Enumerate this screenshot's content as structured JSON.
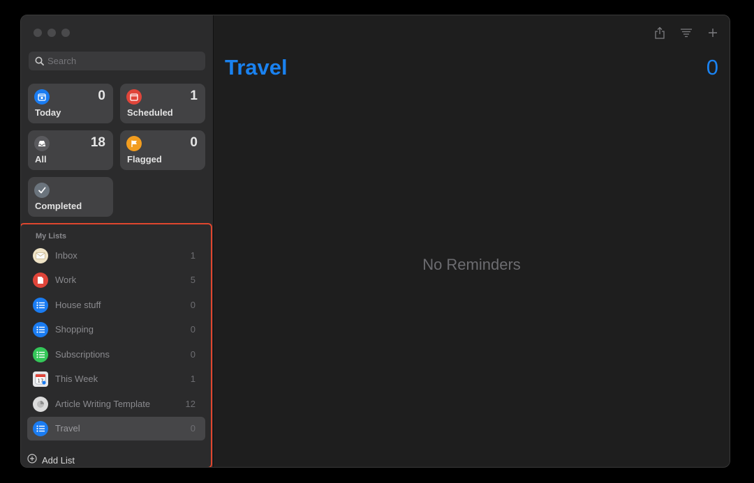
{
  "sidebar": {
    "search": {
      "placeholder": "Search",
      "value": ""
    },
    "smart_lists": [
      {
        "label": "Today",
        "count": "0",
        "color": "#1a7cf2",
        "icon": "calendar-today-icon"
      },
      {
        "label": "Scheduled",
        "count": "1",
        "color": "#e0453a",
        "icon": "calendar-icon"
      },
      {
        "label": "All",
        "count": "18",
        "color": "#5a5a5e",
        "icon": "tray-icon"
      },
      {
        "label": "Flagged",
        "count": "0",
        "color": "#f29d1f",
        "icon": "flag-icon"
      },
      {
        "label": "Completed",
        "count": "",
        "color": "#6b747d",
        "icon": "checkmark-icon"
      }
    ],
    "my_lists_header": "My Lists",
    "lists": [
      {
        "name": "Inbox",
        "count": "1",
        "color": "#efe3c6",
        "icon": "inbox-emoji-icon"
      },
      {
        "name": "Work",
        "count": "5",
        "color": "#e0453a",
        "icon": "document-icon"
      },
      {
        "name": "House stuff",
        "count": "0",
        "color": "#1a7cf2",
        "icon": "list-bullet-icon"
      },
      {
        "name": "Shopping",
        "count": "0",
        "color": "#1a7cf2",
        "icon": "list-bullet-icon"
      },
      {
        "name": "Subscriptions",
        "count": "0",
        "color": "#34c759",
        "icon": "list-bullet-icon"
      },
      {
        "name": "This Week",
        "count": "1",
        "color": "#e8e8ea",
        "icon": "calendar-page-icon"
      },
      {
        "name": "Article Writing Template",
        "count": "12",
        "color": "#dcdcdc",
        "icon": "pie-chart-icon"
      },
      {
        "name": "Travel",
        "count": "0",
        "color": "#1a7cf2",
        "icon": "list-bullet-icon",
        "selected": true
      }
    ],
    "add_list_label": "Add List"
  },
  "main": {
    "title": "Travel",
    "count": "0",
    "empty_text": "No Reminders",
    "accent": "#1a82f0"
  },
  "toolbar": {
    "icons": [
      "share-icon",
      "view-options-icon",
      "add-icon"
    ]
  }
}
